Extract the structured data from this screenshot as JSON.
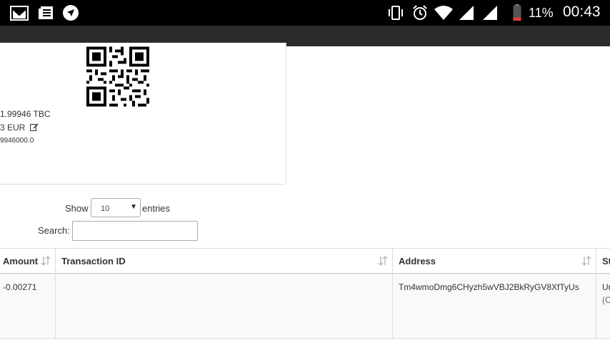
{
  "status_bar": {
    "notification_icons": [
      "gmail-icon",
      "news-icon",
      "send-icon"
    ],
    "system_icons": [
      "vibrate-icon",
      "alarm-icon",
      "wifi-icon",
      "signal-icon",
      "signal-icon",
      "battery-low-icon"
    ],
    "battery": "11%",
    "time": "00:43"
  },
  "wallet": {
    "balance_tbc": "1.99946 TBC",
    "balance_eur": "3 EUR",
    "balance_raw": "9946000.0"
  },
  "table_controls": {
    "show_label": "Show",
    "entries_value": "10",
    "entries_label": "entries",
    "search_label": "Search:",
    "search_value": ""
  },
  "table": {
    "columns": [
      "Amount",
      "Transaction ID",
      "Address",
      "St"
    ],
    "rows": [
      {
        "amount": "-0.00271",
        "transaction_id": "",
        "address": "Tm4wmoDmg6CHyzh5wVBJ2BkRyGV8XfTyUs",
        "status_line1": "Ur",
        "status_line2": "(C"
      }
    ]
  },
  "colors": {
    "status_bar": "#000000",
    "toolbar": "#2b2b2b",
    "battery_low": "#e53935"
  }
}
